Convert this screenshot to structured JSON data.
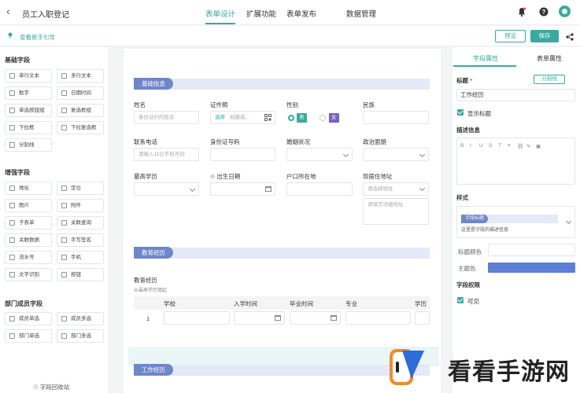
{
  "header": {
    "title": "员工入职登记",
    "tabs": [
      {
        "label": "表单设计",
        "active": true
      },
      {
        "label": "扩展功能",
        "active": false
      },
      {
        "label": "表单发布",
        "active": false
      },
      {
        "label": "数据管理",
        "active": false
      }
    ]
  },
  "guide": {
    "link": "查看新手引导",
    "preview_label": "预览",
    "save_label": "保存"
  },
  "left": {
    "basic_title": "基础字段",
    "basic_items": [
      "单行文本",
      "多行文本",
      "数字",
      "日期时间",
      "单选按钮组",
      "复选框组",
      "下拉框",
      "下拉复选框",
      "分割线"
    ],
    "enhanced_title": "增强字段",
    "enhanced_items": [
      "地址",
      "定位",
      "图片",
      "附件",
      "子表单",
      "关联查询",
      "关联数据",
      "手写签名",
      "流水号",
      "手机",
      "文字识别",
      "按钮"
    ],
    "dept_title": "部门成员字段",
    "dept_items": [
      "成员单选",
      "成员多选",
      "部门单选",
      "部门多选"
    ],
    "recycle": "字段回收站"
  },
  "form": {
    "section_basic": "基础信息",
    "name_label": "姓名",
    "name_placeholder": "身份证约的姓名",
    "photo_label": "证件照",
    "photo_select": "选择",
    "photo_hint": "拍摄或...",
    "gender_label": "性别",
    "gender_male": "男",
    "gender_female": "女",
    "ethnic_label": "民族",
    "phone_label": "联系电话",
    "phone_placeholder": "请输入11位手机号码",
    "idcard_label": "身份证号码",
    "marital_label": "婚姻状况",
    "political_label": "政治面貌",
    "edu_label": "最高学历",
    "birth_label": "出生日期",
    "hukou_label": "户口所在地",
    "address_label": "现居住地址",
    "address_placeholder": "请选择地址",
    "address_detail_placeholder": "请填写详细地址",
    "section_edu": "教育经历",
    "edu_table_title": "教育经历",
    "edu_table_hint": "从最高学历填起",
    "edu_columns": [
      "学校",
      "入学时间",
      "毕业时间",
      "专业",
      "学历"
    ],
    "edu_row_num": "1",
    "section_work": "工作经历"
  },
  "right": {
    "tabs": [
      {
        "label": "字段属性",
        "active": true
      },
      {
        "label": "表单属性",
        "active": false
      }
    ],
    "title_label": "标题",
    "required_mark": "*",
    "divider_btn": "分割线",
    "title_value": "工作经历",
    "show_title": "显示标题",
    "desc_label": "描述信息",
    "toolbar": [
      "B",
      "I",
      "U",
      "S",
      "T",
      "≡",
      "⛓",
      "✎",
      "▣"
    ],
    "style_label": "样式",
    "style_preview_tag": "字段标题",
    "style_preview_desc": "这里是字段的描述信息",
    "title_color_label": "标题颜色",
    "theme_color_label": "主题色",
    "theme_color": "#5b7fd6",
    "perm_label": "字段权限",
    "visible_label": "可见"
  },
  "watermark": {
    "text": "看看手游网"
  },
  "colors": {
    "accent": "#3aa99f",
    "section": "#6f86c9",
    "male_tag": "#3aa99f",
    "female_tag": "#7a5fc4"
  }
}
